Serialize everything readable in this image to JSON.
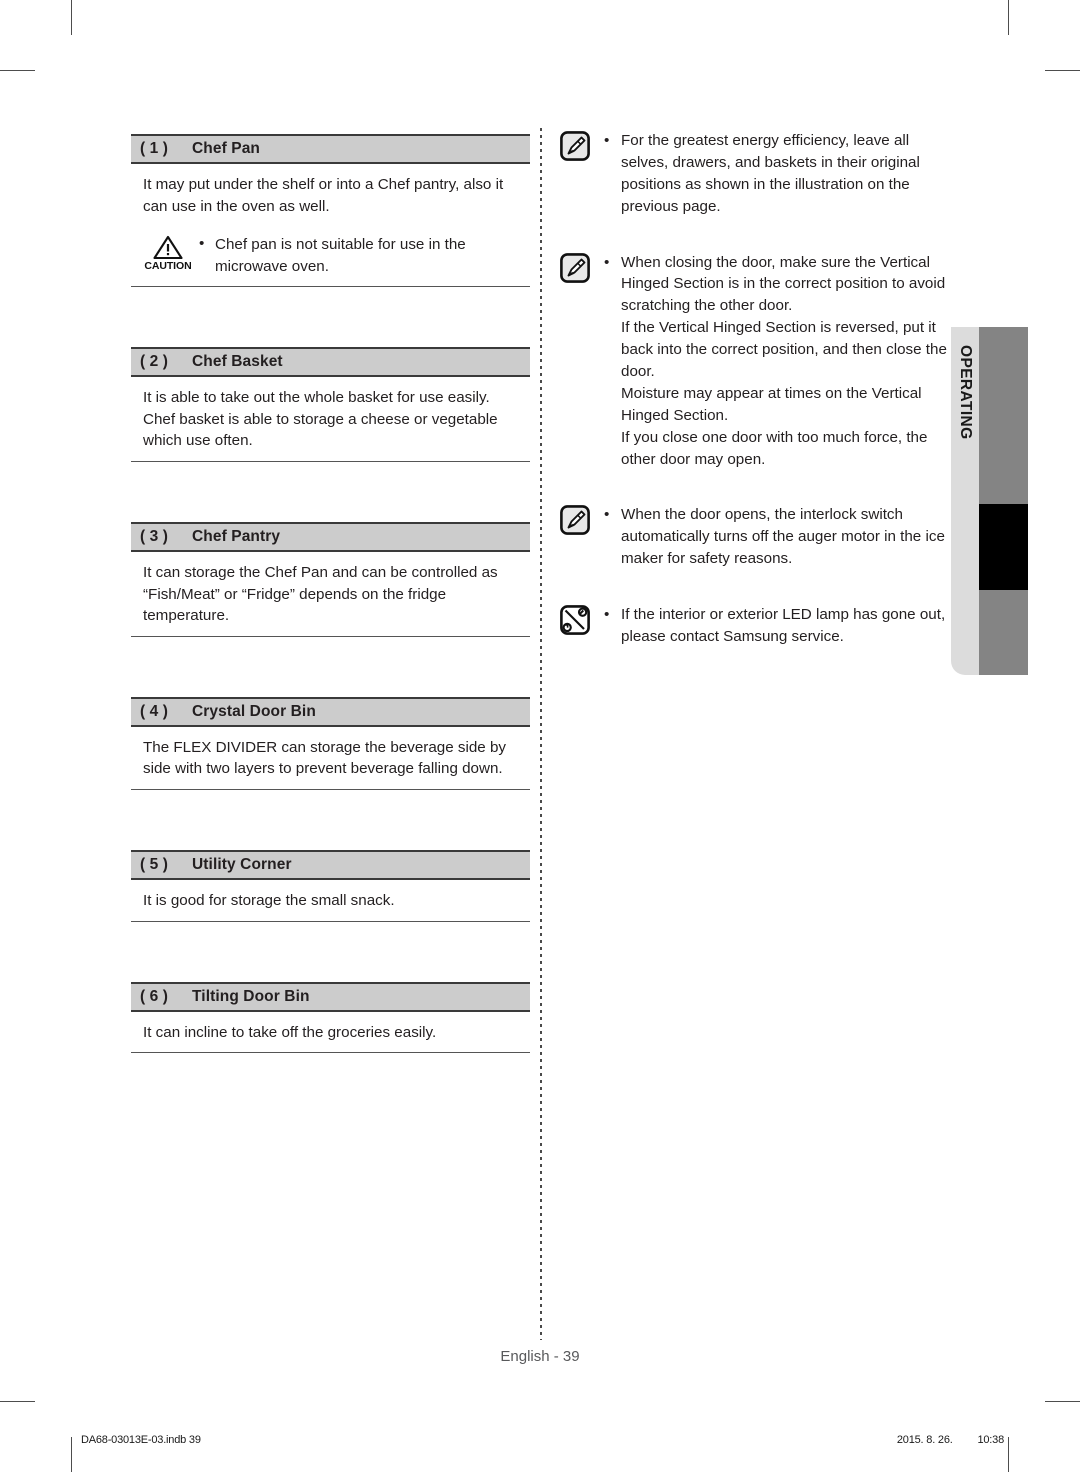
{
  "document": {
    "page_label": "English - 39",
    "side_tab_label": "OPERATING"
  },
  "left_column": {
    "sections": [
      {
        "number": "( 1 )",
        "title": "Chef Pan",
        "body": "It may put under the shelf or into a Chef pantry, also it can use in the oven as well.",
        "caution": {
          "label": "CAUTION",
          "text": "Chef pan is not suitable for use in the microwave oven."
        }
      },
      {
        "number": "( 2 )",
        "title": "Chef Basket",
        "body_line1": "It is able to take out the whole basket for use easily.",
        "body_line2": "Chef basket is able to storage a cheese or vegetable which use often."
      },
      {
        "number": "( 3 )",
        "title": "Chef Pantry",
        "body": "It can storage the Chef Pan and can be controlled as “Fish/Meat” or “Fridge” depends on the fridge temperature."
      },
      {
        "number": "( 4 )",
        "title": "Crystal Door Bin",
        "body": "The FLEX DIVIDER can storage the beverage side by side with two layers to prevent beverage falling down."
      },
      {
        "number": "( 5 )",
        "title": "Utility Corner",
        "body": "It is good for storage the small snack."
      },
      {
        "number": "( 6 )",
        "title": "Tilting Door Bin",
        "body": "It can incline to take off the groceries easily."
      }
    ]
  },
  "right_column": {
    "notes": [
      {
        "icon": "note-pencil-icon",
        "lines": [
          "For the greatest energy efficiency, leave all selves, drawers, and baskets in their original positions as shown in the illustration on the previous page."
        ]
      },
      {
        "icon": "note-pencil-icon",
        "lines": [
          "When closing the door, make sure the Vertical Hinged Section is in the correct position to avoid scratching the other door.",
          "If the Vertical Hinged Section is reversed, put it back into the correct position, and then close the door.",
          "Moisture may appear at times on the Vertical Hinged Section.",
          "If you close one door with too much force, the other door may open."
        ]
      },
      {
        "icon": "note-pencil-icon",
        "lines": [
          "When the door opens, the interlock switch automatically turns off the auger motor in the ice maker for safety reasons."
        ]
      },
      {
        "icon": "service-tools-icon",
        "lines": [
          "If the interior or exterior LED lamp has gone out, please contact Samsung service."
        ]
      }
    ]
  },
  "print_footer": {
    "file": "DA68-03013E-03.indb   39",
    "date": "2015. 8. 26.",
    "time": "10:38"
  },
  "colors": {
    "header_bar": "#cccccc",
    "rule": "#3a3a3a",
    "tab_light": "#dcdcdc",
    "tab_dark": "#848484",
    "tab_black": "#000000",
    "text": "#231f20",
    "page_number": "#58595b"
  }
}
